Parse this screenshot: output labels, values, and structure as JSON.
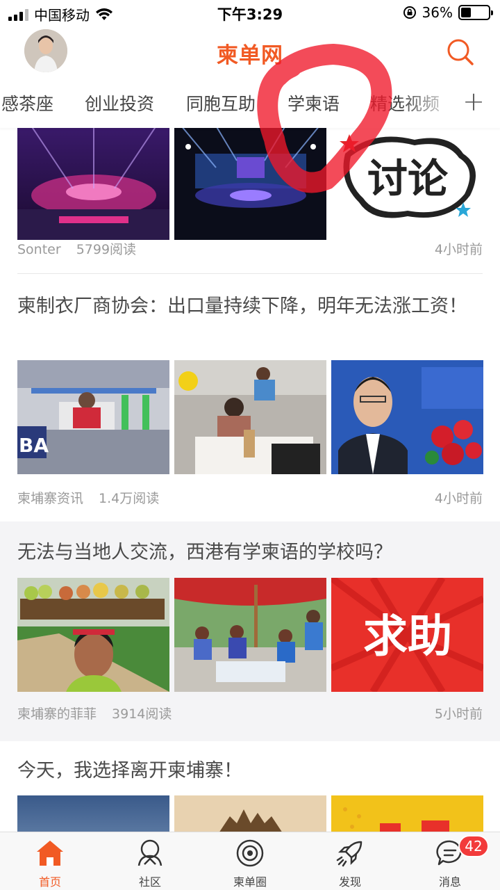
{
  "status_bar": {
    "carrier": "中国移动",
    "time": "下午3:29",
    "battery": "36%",
    "battery_level": 0.36
  },
  "header": {
    "logo": "柬单网",
    "avatar_icon": "user-avatar",
    "search_icon": "search-icon"
  },
  "channel_tabs": [
    "感茶座",
    "创业投资",
    "同胞互助",
    "学柬语",
    "精选视频"
  ],
  "articles": [
    {
      "title": "",
      "source": "Sonter",
      "reads": "5799阅读",
      "time": "4小时前",
      "image_text": "讨论"
    },
    {
      "title": "柬制衣厂商协会：出口量持续下降，明年无法涨工资！",
      "source": "柬埔寨资讯",
      "reads": "1.4万阅读",
      "time": "4小时前",
      "image_text": "BA"
    },
    {
      "title": "无法与当地人交流，西港有学柬语的学校吗？",
      "source": "柬埔寨的菲菲",
      "reads": "3914阅读",
      "time": "5小时前",
      "image_text": "求助"
    },
    {
      "title": "今天，我选择离开柬埔寨！"
    }
  ],
  "tab_bar": {
    "items": [
      {
        "label": "首页",
        "icon": "home-icon",
        "active": true
      },
      {
        "label": "社区",
        "icon": "community-icon"
      },
      {
        "label": "柬单圈",
        "icon": "circle-icon"
      },
      {
        "label": "发现",
        "icon": "rocket-icon"
      },
      {
        "label": "消息",
        "icon": "message-icon",
        "badge": "42"
      }
    ]
  },
  "colors": {
    "brand": "#f15a24",
    "badge": "#f23b3b",
    "meta_text": "#9a9a9a"
  }
}
